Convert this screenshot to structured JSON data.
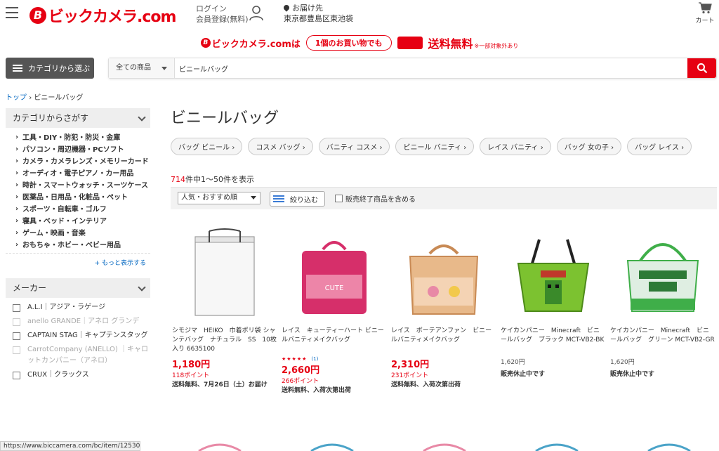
{
  "header": {
    "logo_mark": "B",
    "logo_text": "ビックカメラ.com",
    "login": "ログイン",
    "register": "会員登録(無料)",
    "deliver_label": "お届け先",
    "deliver_address": "東京都豊島区東池袋",
    "cart_label": "カート"
  },
  "banner": {
    "logo_text": "ビックカメラ.comは",
    "pill": "1個のお買い物でも",
    "free": "送料無料",
    "note": "※一部対象外あり"
  },
  "search": {
    "category_button": "カテゴリから選ぶ",
    "scope": "全ての商品",
    "value": "ビニールバッグ"
  },
  "sidebar": {
    "breadcrumb_home": "トップ",
    "breadcrumb_sep": "›",
    "breadcrumb_current": "ビニールバッグ",
    "category_title": "カテゴリからさがす",
    "categories": [
      "工具・DIY・防犯・防災・金庫",
      "パソコン・周辺機器・PCソフト",
      "カメラ・カメラレンズ・メモリーカード",
      "オーディオ・電子ピアノ・カー用品",
      "時計・スマートウォッチ・スーツケース",
      "医薬品・日用品・化粧品・ペット",
      "スポーツ・自転車・ゴルフ",
      "寝具・ベッド・インテリア",
      "ゲーム・映画・音楽",
      "おもちゃ・ホビー・ベビー用品"
    ],
    "more": "+ もっと表示する",
    "maker_title": "メーカー",
    "makers": [
      {
        "label": "A.L.I｜アジア・ラゲージ",
        "dim": false
      },
      {
        "label": "anello GRANDE｜アネロ グランデ",
        "dim": true
      },
      {
        "label": "CAPTAIN STAG｜キャプテンスタッグ",
        "dim": false
      },
      {
        "label": "CarrotCompany (ANELLO) ｜キャロットカンパニー（アネロ）",
        "dim": true
      },
      {
        "label": "CRUX｜クラックス",
        "dim": false
      }
    ]
  },
  "main": {
    "title": "ビニールバッグ",
    "tags": [
      "バッグ ビニール ›",
      "コスメ バッグ ›",
      "バニティ コスメ ›",
      "ビニール バニティ ›",
      "レイス バニティ ›",
      "バッグ 女の子 ›",
      "バッグ レイス ›"
    ],
    "count_num": "714",
    "count_text": "件中1〜50件を表示",
    "sort": "人気・おすすめ順",
    "narrow": "絞り込む",
    "include_label": "販売終了商品を含める"
  },
  "products": [
    {
      "name": "シモジマ　HEIKO　巾着ポリ袋 シャンテバッグ　ナチュラル　SS　10枚入り 6635100",
      "price": "1,180円",
      "points": "118ポイント",
      "ship": "送料無料、7月26日（土）お届け",
      "color": "#ffffff"
    },
    {
      "name": "レイス　キューティーハート ビニールバニティメイクバッグ",
      "stars": "★★★★★",
      "reviews": "(1)",
      "price": "2,660円",
      "points": "266ポイント",
      "ship": "送料無料、入荷次第出荷",
      "color": "#d62f6a"
    },
    {
      "name": "レイス　ボーテアンファン　ビニールバニティメイクバッグ",
      "price": "2,310円",
      "points": "231ポイント",
      "ship": "送料無料、入荷次第出荷",
      "color": "#d9a06a"
    },
    {
      "name": "ケイカンパニー　Minecraft　ビニールバッグ　ブラック MCT-VB2-BK",
      "price_grey": "1,620円",
      "stop": "販売休止中です",
      "color": "#7cc230"
    },
    {
      "name": "ケイカンパニー　Minecraft　ビニールバッグ　グリーン MCT-VB2-GR",
      "price_grey": "1,620円",
      "stop": "販売休止中です",
      "color": "#3fae49"
    }
  ],
  "status_url": "https://www.biccamera.com/bc/item/12530281/"
}
